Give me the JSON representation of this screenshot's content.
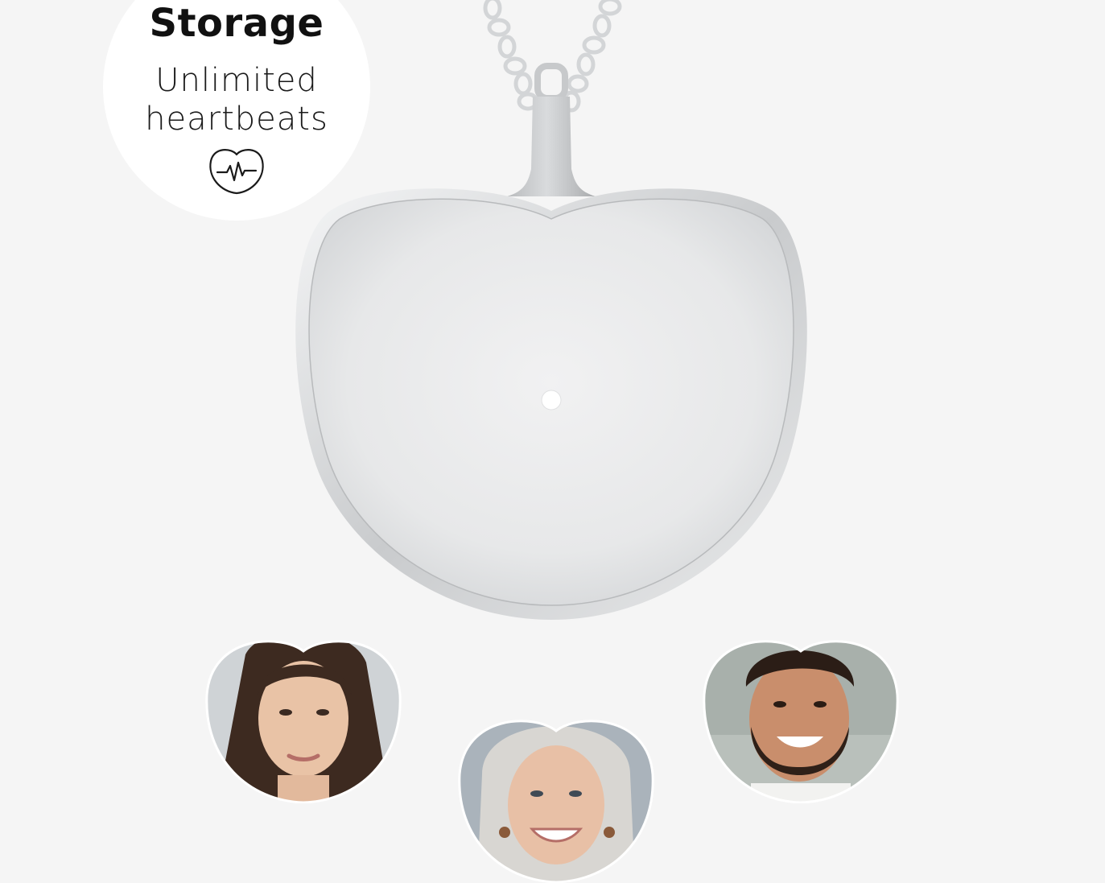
{
  "badge": {
    "title": "Storage",
    "line1": "Unlimited",
    "line2": "heartbeats",
    "icon": "heartbeat-heart-icon"
  },
  "product": {
    "name": "heart-pendant-necklace",
    "finish": "silver"
  },
  "portraits": [
    {
      "icon": "portrait-young-woman"
    },
    {
      "icon": "portrait-older-woman"
    },
    {
      "icon": "portrait-bearded-man"
    }
  ],
  "colors": {
    "background": "#f5f5f5",
    "badge": "#ffffff",
    "text": "#111111",
    "silver": "#d0d2d4"
  }
}
